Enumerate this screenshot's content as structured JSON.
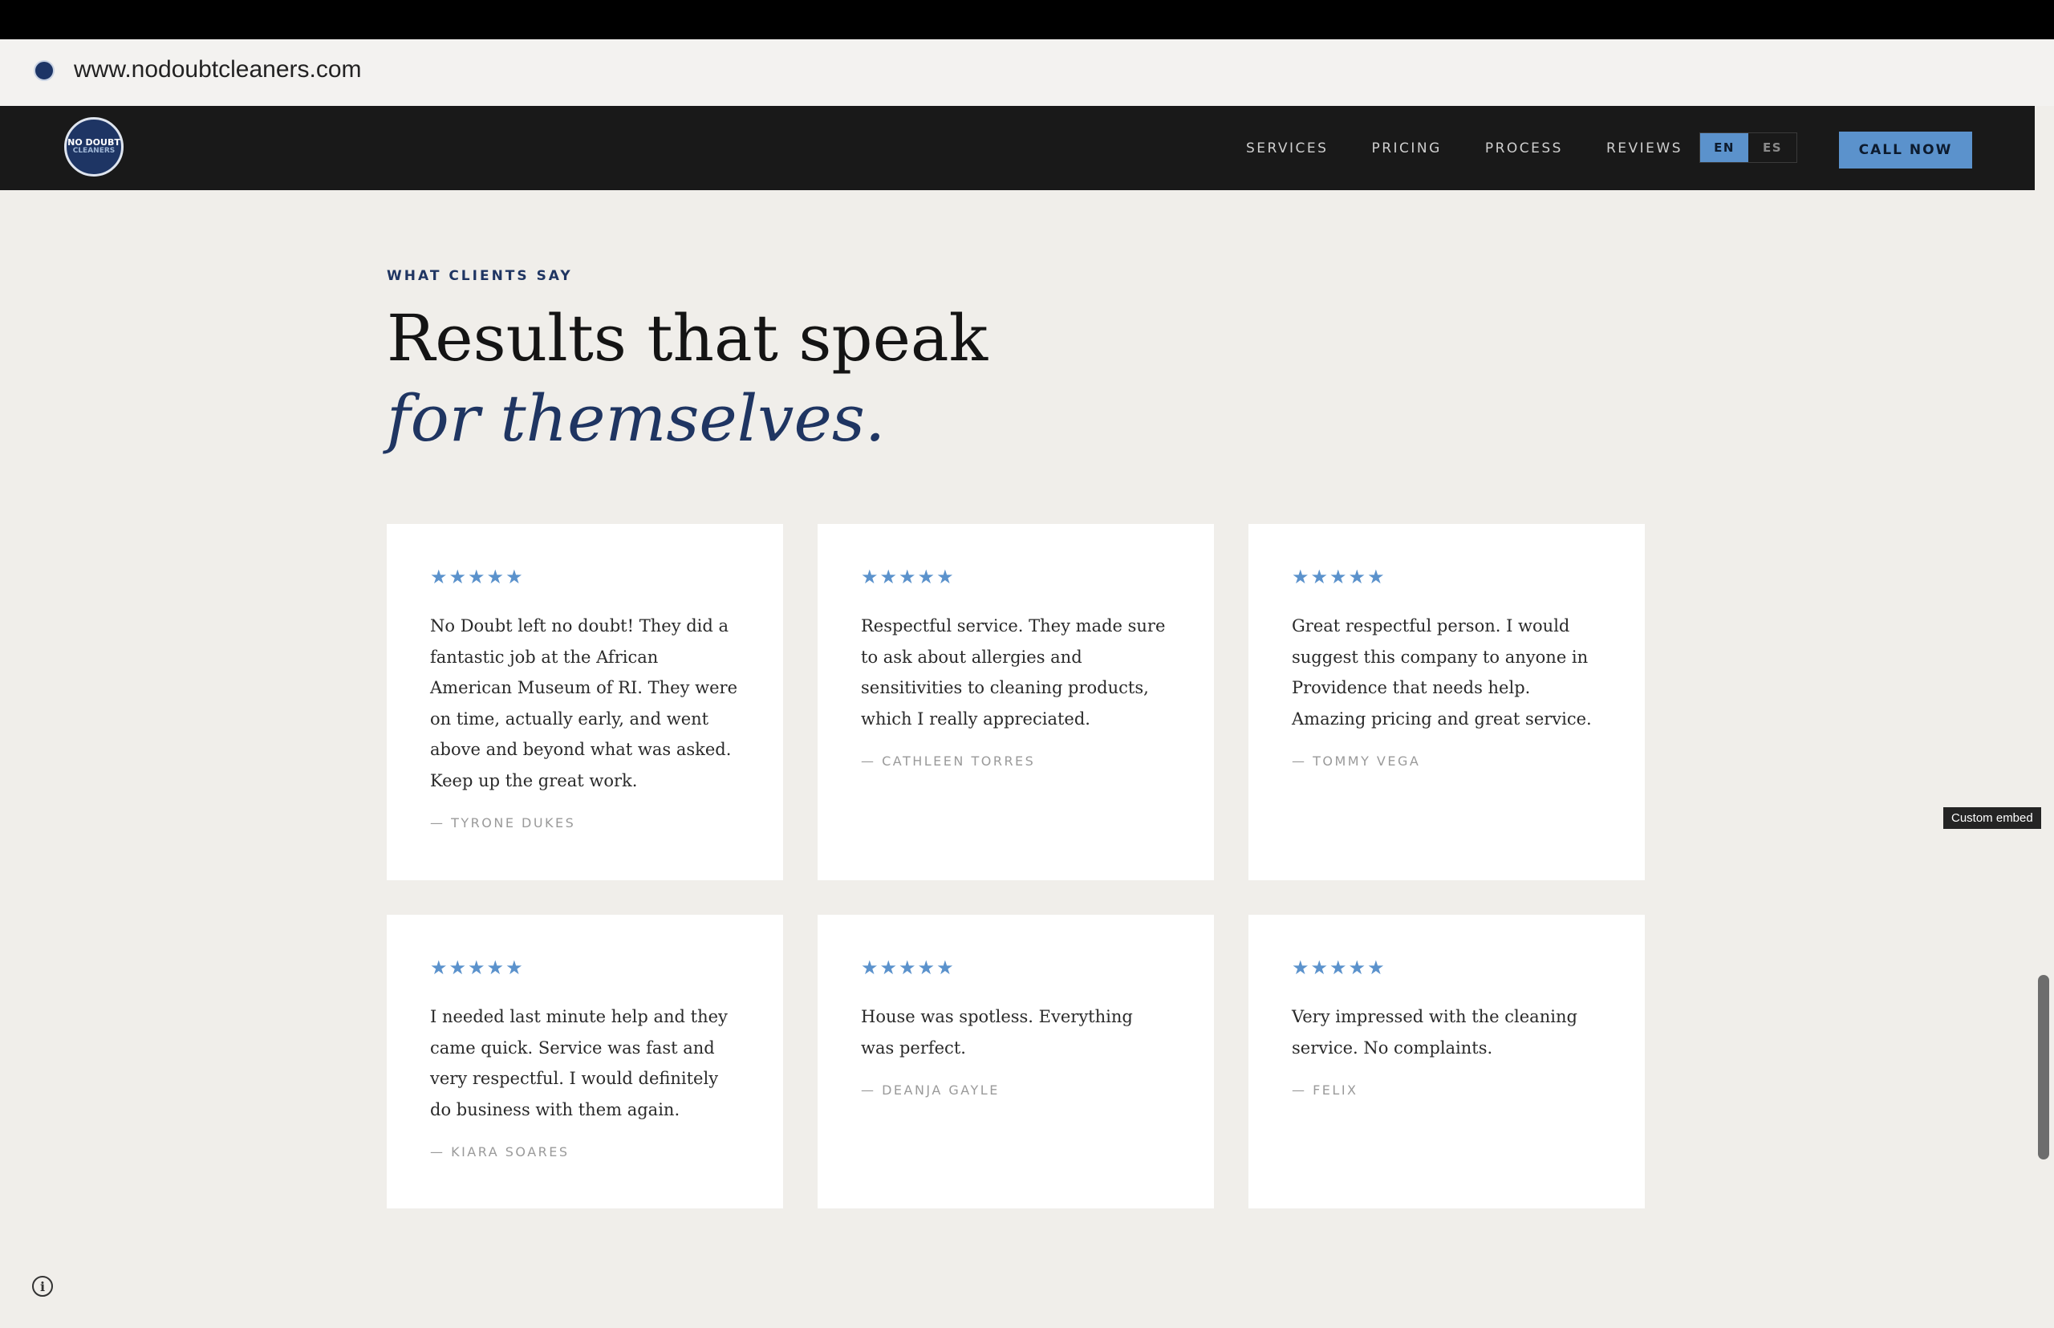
{
  "browser": {
    "url": "www.nodoubtcleaners.com"
  },
  "nav": {
    "logo_text_1": "NO DOUBT",
    "logo_text_2": "CLEANERS",
    "links": [
      "SERVICES",
      "PRICING",
      "PROCESS",
      "REVIEWS"
    ],
    "lang_en": "EN",
    "lang_es": "ES",
    "cta": "CALL NOW"
  },
  "section": {
    "eyebrow": "WHAT CLIENTS SAY",
    "heading_line1": "Results that speak",
    "heading_line2": "for themselves."
  },
  "reviews": [
    {
      "stars": "★★★★★",
      "text": "No Doubt left no doubt! They did a fantastic job at the African American Museum of RI. They were on time, actually early, and went above and beyond what was asked. Keep up the great work.",
      "author": "— TYRONE DUKES"
    },
    {
      "stars": "★★★★★",
      "text": "Respectful service. They made sure to ask about allergies and sensitivities to cleaning products, which I really appreciated.",
      "author": "— CATHLEEN TORRES"
    },
    {
      "stars": "★★★★★",
      "text": "Great respectful person. I would suggest this company to anyone in Providence that needs help. Amazing pricing and great service.",
      "author": "— TOMMY VEGA"
    },
    {
      "stars": "★★★★★",
      "text": "I needed last minute help and they came quick. Service was fast and very respectful. I would definitely do business with them again.",
      "author": "— KIARA SOARES"
    },
    {
      "stars": "★★★★★",
      "text": "House was spotless. Everything was perfect.",
      "author": "— DEANJA GAYLE"
    },
    {
      "stars": "★★★★★",
      "text": "Very impressed with the cleaning service. No complaints.",
      "author": "— FELIX"
    }
  ],
  "overlay": {
    "embed_label": "Custom embed",
    "info_glyph": "i"
  },
  "colors": {
    "accent": "#5b92cc",
    "navy": "#1f3562",
    "nav_bg": "#191919",
    "page_bg": "#f0eeea"
  }
}
